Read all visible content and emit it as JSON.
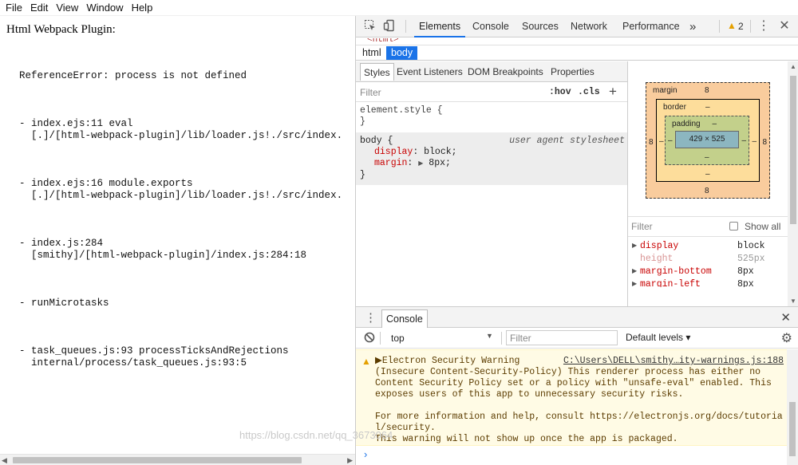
{
  "menubar": {
    "items": [
      "File",
      "Edit",
      "View",
      "Window",
      "Help"
    ]
  },
  "page": {
    "title": "Html Webpack Plugin:",
    "error": "ReferenceError: process is not defined",
    "stack": [
      {
        "line1": "- index.ejs:11 eval",
        "line2": "  [.]/[html-webpack-plugin]/lib/loader.js!./src/index."
      },
      {
        "line1": "- index.ejs:16 module.exports",
        "line2": "  [.]/[html-webpack-plugin]/lib/loader.js!./src/index."
      },
      {
        "line1": "- index.js:284",
        "line2": "  [smithy]/[html-webpack-plugin]/index.js:284:18"
      },
      {
        "line1": "- runMicrotasks",
        "line2": ""
      },
      {
        "line1": "- task_queues.js:93 processTicksAndRejections",
        "line2": "  internal/process/task_queues.js:93:5"
      }
    ]
  },
  "devtools": {
    "tabs": [
      "Elements",
      "Console",
      "Sources",
      "Network",
      "Performance"
    ],
    "more": "»",
    "warning_count": "2",
    "breadcrumbs": [
      "html",
      "body"
    ],
    "subtabs": [
      "Styles",
      "Event Listeners",
      "DOM Breakpoints",
      "Properties"
    ],
    "styles": {
      "filter_placeholder": "Filter",
      "hov": ":hov",
      "cls": ".cls",
      "plus": "+",
      "element_style": "element.style {",
      "element_close": "}",
      "body_selector": "body {",
      "ua_label": "user agent stylesheet",
      "decl1_name": "display",
      "decl1_value": " block;",
      "decl2_name": "margin",
      "decl2_value": "8px;",
      "body_close": "}"
    },
    "box_model": {
      "margin_label": "margin",
      "margin_top": "8",
      "margin_right": "8",
      "margin_bottom": "8",
      "margin_left": "8",
      "border_label": "border",
      "border_top": "–",
      "border_right": "–",
      "border_bottom": "–",
      "border_left": "–",
      "padding_label": "padding",
      "padding_top": "–",
      "padding_right": "–",
      "padding_bottom": "–",
      "padding_left": "–",
      "content": "429 × 525"
    },
    "computed": {
      "filter_placeholder": "Filter",
      "show_all": "Show all",
      "rows": [
        {
          "name": "display",
          "value": "block",
          "inherited": false,
          "expandable": true
        },
        {
          "name": "height",
          "value": "525px",
          "inherited": true,
          "expandable": false
        },
        {
          "name": "margin-bottom",
          "value": "8px",
          "inherited": false,
          "expandable": true
        },
        {
          "name": "margin-left",
          "value": "8px",
          "inherited": false,
          "expandable": true
        }
      ]
    },
    "drawer": {
      "tab": "Console",
      "context": "top",
      "filter_placeholder": "Filter",
      "levels": "Default levels ▾",
      "warning": {
        "source": "C:\\Users\\DELL\\smithy…ity-warnings.js:188",
        "text": "▶Electron Security Warning\n(Insecure Content-Security-Policy) This renderer process has either no\nContent Security Policy set or a policy with \"unsafe-eval\" enabled. This\nexposes users of this app to unnecessary security risks.\n\nFor more information and help, consult https://electronjs.org/docs/tutoria\nl/security.\nThis warning will not show up once the app is packaged."
      },
      "prompt": "›"
    }
  },
  "watermark": "https://blog.csdn.net/qq_3673064",
  "colors": {
    "accent": "#1a73e8",
    "warning_bg": "#fffbe5",
    "css_prop": "#c80000"
  }
}
